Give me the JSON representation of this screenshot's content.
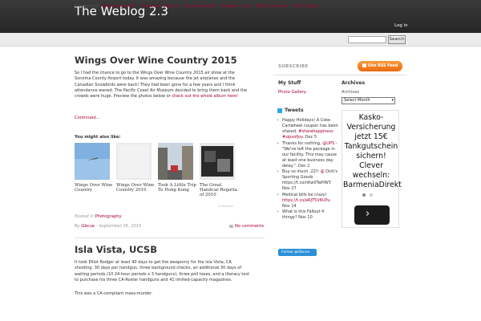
{
  "header": {
    "site_title": "The Weblog 2.3",
    "login_label": "Log in"
  },
  "categories": {
    "label": "Categories:",
    "items": [
      "Awesome Stuff",
      "Customer Service",
      "Entertainment",
      "Hobbies",
      "Life",
      "Politics & News",
      "Technology"
    ]
  },
  "search": {
    "placeholder": "",
    "button_label": "Search"
  },
  "post1": {
    "title": "Wings Over Wine Country 2015",
    "body": "So I had the chance to go to the Wings Over Wine Country 2015 air show at the Sonoma County Airport today. It was amazing because the jet airplanes and the Canadian Snowbirds were back! They had been gone for a few years and I think attendance waned. The Pacific Coast Air Museum decided to bring them back and the crowds were huge. Preview the photos below or",
    "body_link": "check out the whole album here!",
    "continued": "Continued…",
    "also_like": "You might also like:",
    "related": [
      {
        "caption": "Wings Over Wine Country"
      },
      {
        "caption": "Wings Over Wine Country 2010"
      },
      {
        "caption": "Took A Little Trip To Hong Kong"
      },
      {
        "caption": "The Great Handcar Regatta of 2010"
      }
    ],
    "subscribe_tiny": "Linkwithin",
    "posted_in_label": "Posted in",
    "category": "Photography",
    "by_label": "By",
    "author": "Gbcue",
    "date": "September 26, 2015",
    "comments": "No comments"
  },
  "post2": {
    "title": "Isla Vista, UCSB",
    "body1": "It took Elliot Rodger at least 90 days to get the weaponry for the Isla Vista, CA shooting. 30 days per handgun, three background checks, an additional 30 days of waiting periods (10 24-hour periods x 3 handguns), three poll taxes, and a literacy test to purchase his three CA-Roster handguns and 41 limited-capacity magazines.",
    "body2": "This was a CA-compliant mass-murder."
  },
  "sidebar": {
    "subscribe": "SUBSCRIBE",
    "rss_label": "Site RSS Feed",
    "my_stuff_title": "My Stuff",
    "photo_gallery": "Photo Gallery",
    "archives_title": "Archives",
    "archives_label": "Archives",
    "archives_select": "Select Month",
    "tweets_title": "Tweets",
    "tweets": [
      {
        "pre": "Happy Holidays! A Coke Cartwheel coupon has been shared. ",
        "hl": "#sharehappiness #sipsofjoy",
        "post": ". Dec 5"
      },
      {
        "pre": "Thanks for nothing, ",
        "hl": "@UPS",
        "post": " - \"We've left the package in our facility. This may cause at least one business day delay.\". Dec 2"
      },
      {
        "pre": "Buy so much .22!! ",
        "hl": "@",
        "post": " Dick's Sporting Goods https://t.co/nKw0TwHWY. Nov 27"
      },
      {
        "pre": "Medical bills be crazy! ",
        "hl": "https://t.co/eRJT5V6UPu",
        "post": ". Nov 14"
      },
      {
        "pre": "What is this Fallout 4 thingy? ",
        "hl": "",
        "post": "Nov 10"
      }
    ],
    "follow_label": "Follow @Gbcue"
  },
  "ad": {
    "text": "Kasko-Versicherung jetzt 15€ Tankgutschein sichern! Clever wechseln: BarmeniaDirekt"
  },
  "colors": {
    "accent": "#a5002a",
    "header_bg": "#2e2e2e",
    "rss": "#f07a1a",
    "twitter": "#2b8fd6"
  }
}
